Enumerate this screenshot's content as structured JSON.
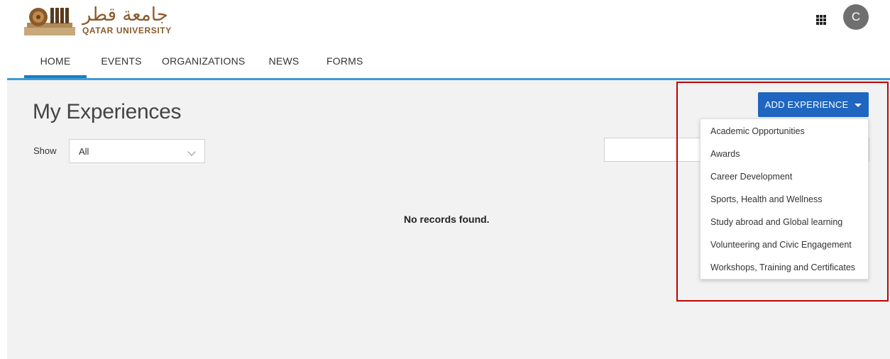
{
  "header": {
    "logo": {
      "arabic": "جامعة قطر",
      "english": "QATAR UNIVERSITY"
    },
    "apps_icon": "apps-grid-icon",
    "avatar_initial": "C"
  },
  "nav": {
    "items": [
      {
        "label": "HOME",
        "active": true
      },
      {
        "label": "EVENTS",
        "active": false
      },
      {
        "label": "ORGANIZATIONS",
        "active": false
      },
      {
        "label": "NEWS",
        "active": false
      },
      {
        "label": "FORMS",
        "active": false
      }
    ]
  },
  "page": {
    "title": "My Experiences",
    "show_label": "Show",
    "show_value": "All",
    "search_value": "",
    "empty_message": "No records found."
  },
  "add_experience": {
    "label": "ADD EXPERIENCE",
    "options": [
      "Academic Opportunities",
      "Awards",
      "Career Development",
      "Sports, Health and Wellness",
      "Study abroad and Global learning",
      "Volunteering and Civic Engagement",
      "Workshops, Training and Certificates"
    ]
  },
  "colors": {
    "accent_blue": "#1f66c1",
    "nav_underline": "#1a7fc1",
    "brand_brown": "#8a5a2b",
    "highlight_red": "#c00000"
  }
}
